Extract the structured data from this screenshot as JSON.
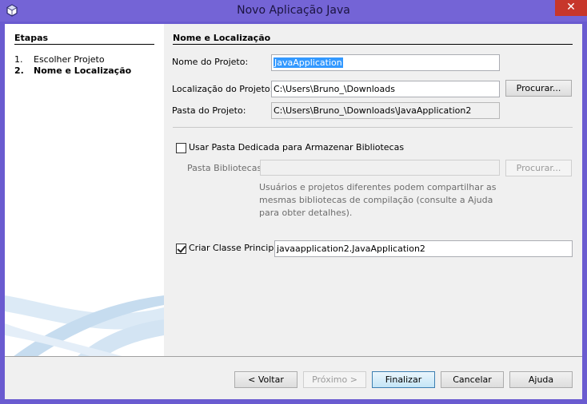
{
  "window": {
    "title": "Novo Aplicação Java",
    "close_symbol": "✕",
    "colors": {
      "titlebar": "#7464d6",
      "close": "#c7362b",
      "selection": "#3399ff"
    }
  },
  "steps": {
    "title": "Etapas",
    "items": [
      {
        "num": "1.",
        "label": "Escolher Projeto"
      },
      {
        "num": "2.",
        "label": "Nome e Localização"
      }
    ]
  },
  "form": {
    "section_title": "Nome e Localização",
    "project_name_label": "Nome do Projeto:",
    "project_name_value": "JavaApplication",
    "project_location_label": "Localização do Projeto:",
    "project_location_value": "C:\\Users\\Bruno_\\Downloads",
    "browse_label": "Procurar...",
    "project_folder_label": "Pasta do Projeto:",
    "project_folder_value": "C:\\Users\\Bruno_\\Downloads\\JavaApplication2",
    "dedicated_folder_label": "Usar Pasta Dedicada para Armazenar Bibliotecas",
    "dedicated_folder_checked": false,
    "libraries_folder_label": "Pasta Bibliotecas:",
    "libraries_folder_value": "",
    "libraries_browse_label": "Procurar...",
    "help_text": "Usuários e projetos diferentes podem compartilhar as mesmas bibliotecas de compilação (consulte a Ajuda para obter detalhes).",
    "main_class_label": "Criar Classe Principal",
    "main_class_checked": true,
    "main_class_value": "javaapplication2.JavaApplication2"
  },
  "footer": {
    "back_label": "< Voltar",
    "next_label": "Próximo >",
    "finish_label": "Finalizar",
    "cancel_label": "Cancelar",
    "help_label": "Ajuda"
  }
}
